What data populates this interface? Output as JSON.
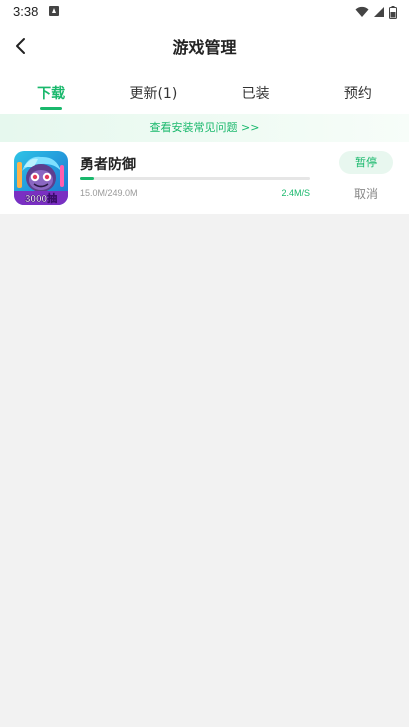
{
  "status_bar": {
    "time": "3:38",
    "icons": [
      "notification-a-icon",
      "wifi-icon",
      "signal-icon",
      "battery-icon"
    ]
  },
  "header": {
    "title": "游戏管理",
    "back_icon": "chevron-left-icon"
  },
  "tabs": [
    {
      "label": "下载",
      "active": true
    },
    {
      "label": "更新(1)",
      "active": false
    },
    {
      "label": "已装",
      "active": false
    },
    {
      "label": "预约",
      "active": false
    }
  ],
  "faq_banner": {
    "text": "查看安装常见问题 >>"
  },
  "downloads": [
    {
      "name": "勇者防御",
      "icon_badge": "3000抽",
      "downloaded": "15.0M/249.0M",
      "speed": "2.4M/S",
      "progress_fraction": 0.06,
      "pause_label": "暂停",
      "cancel_label": "取消"
    }
  ],
  "colors": {
    "accent": "#19b86c",
    "background": "#f2f2f2"
  }
}
